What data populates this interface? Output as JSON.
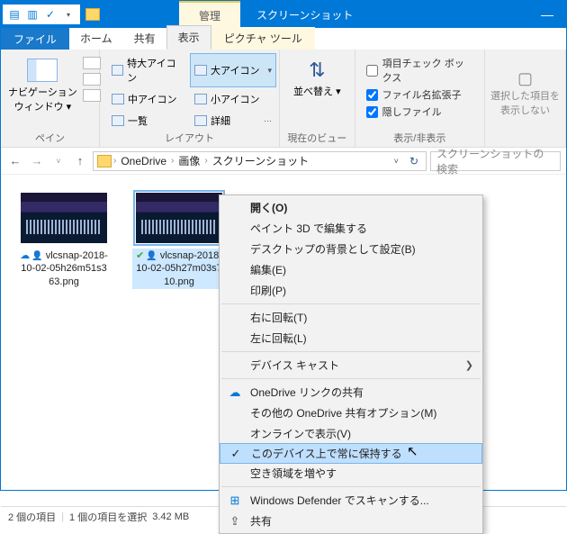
{
  "titlebar": {
    "context_tab": "管理",
    "title": "スクリーンショット",
    "minimize": "—"
  },
  "tabs": {
    "file": "ファイル",
    "home": "ホーム",
    "share": "共有",
    "view": "表示",
    "picture_tools": "ピクチャ ツール"
  },
  "ribbon": {
    "pane_group": "ペイン",
    "nav_pane": "ナビゲーション\nウィンドウ ▾",
    "layout_group": "レイアウト",
    "extra_large": "特大アイコン",
    "large": "大アイコン",
    "medium": "中アイコン",
    "small": "小アイコン",
    "list": "一覧",
    "details": "詳細",
    "current_view_group": "現在のビュー",
    "sort": "並べ替え ▾",
    "showhide_group": "表示/非表示",
    "item_checkboxes": "項目チェック ボックス",
    "file_ext": "ファイル名拡張子",
    "hidden_files": "隠しファイル",
    "hide_selected": "選択した項目を\n表示しない"
  },
  "address": {
    "crumb1": "OneDrive",
    "crumb2": "画像",
    "crumb3": "スクリーンショット",
    "search_placeholder": "スクリーンショットの検索"
  },
  "files": [
    {
      "name": "vlcsnap-2018-10-02-05h26m51s363.png",
      "status": "cloud"
    },
    {
      "name": "vlcsnap-2018-10-02-05h27m03s710.png",
      "status": "synced"
    }
  ],
  "statusbar": {
    "item_count": "2 個の項目",
    "selected": "1 個の項目を選択",
    "size": "3.42 MB"
  },
  "context_menu": {
    "open": "開く(O)",
    "paint3d": "ペイント 3D で編集する",
    "set_bg": "デスクトップの背景として設定(B)",
    "edit": "編集(E)",
    "print": "印刷(P)",
    "rotate_r": "右に回転(T)",
    "rotate_l": "左に回転(L)",
    "cast": "デバイス キャスト",
    "onedrive_share": "OneDrive リンクの共有",
    "onedrive_more": "その他の OneDrive 共有オプション(M)",
    "view_online": "オンラインで表示(V)",
    "always_keep": "このデバイス上で常に保持する",
    "free_space": "空き領域を増やす",
    "defender": "Windows Defender でスキャンする...",
    "share": "共有"
  }
}
